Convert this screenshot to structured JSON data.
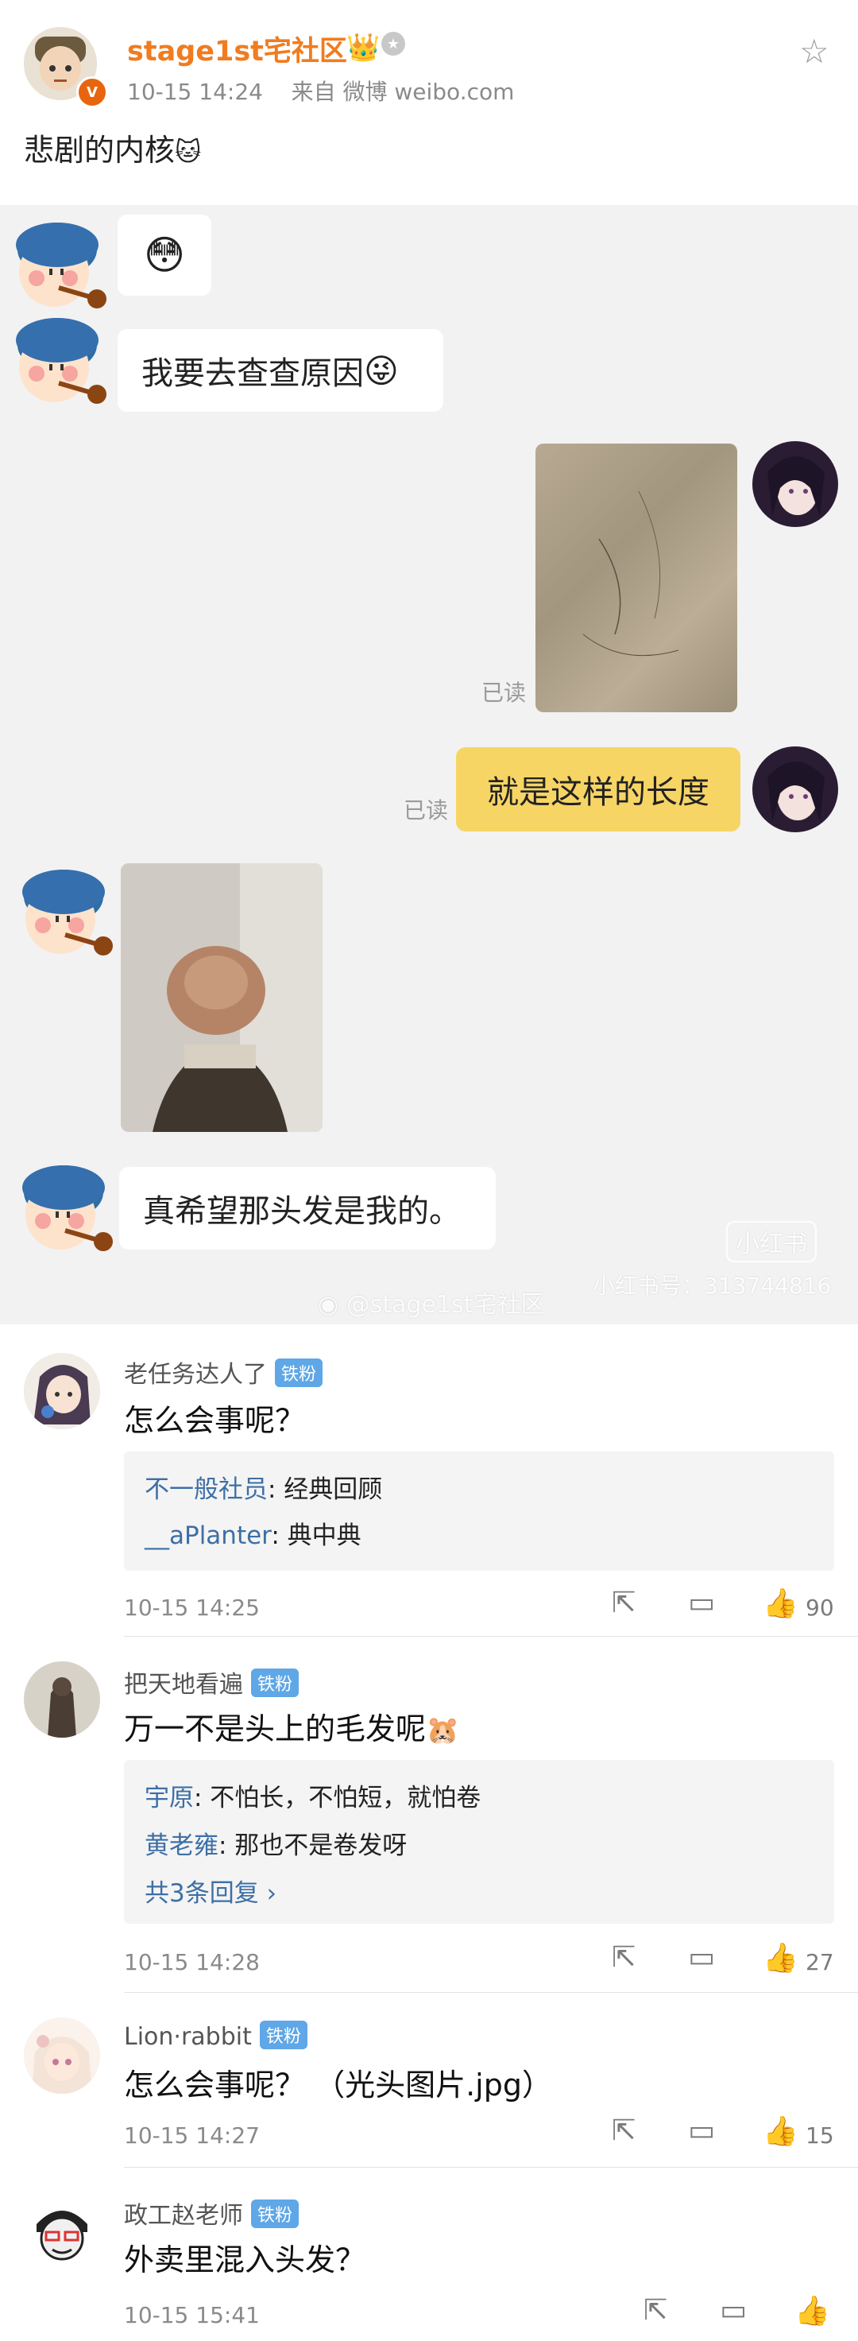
{
  "post": {
    "author": "stage1st宅社区",
    "time": "10-15 14:24",
    "source": "来自 微博 weibo.com",
    "text": "悲剧的内核",
    "emoji": "🐱"
  },
  "chat": {
    "msg1_emoji": "😳",
    "msg2": "我要去查查原因",
    "msg2_emoji": "😜",
    "read1": "已读",
    "msg4": "就是这样的长度",
    "read2": "已读",
    "msg6": "真希望那头发是我的。",
    "watermark_app": "小红书",
    "watermark_id": "小红书号：313744816",
    "watermark_weibo": "@stage1st宅社区"
  },
  "comments": [
    {
      "user": "老任务达人了",
      "badge": "铁粉",
      "text": "怎么会事呢？",
      "replies": [
        {
          "user": "不一般社员",
          "text": ": 经典回顾"
        },
        {
          "user": "__aPlanter",
          "text": ": 典中典"
        }
      ],
      "time": "10-15 14:25",
      "likes": "90"
    },
    {
      "user": "把天地看遍",
      "badge": "铁粉",
      "text": "万一不是头上的毛发呢",
      "emoji": "🐹",
      "replies": [
        {
          "user": "宇原",
          "text": ": 不怕长，不怕短，就怕卷"
        },
        {
          "user": "黄老雍",
          "text": ": 那也不是卷发呀"
        }
      ],
      "more": "共3条回复 ›",
      "time": "10-15 14:28",
      "likes": "27"
    },
    {
      "user": "Lion·rabbit",
      "badge": "铁粉",
      "text": "怎么会事呢？ （光头图片.jpg）",
      "time": "10-15 14:27",
      "likes": "15"
    },
    {
      "user": "政工赵老师",
      "badge": "铁粉",
      "text": "外卖里混入头发？",
      "time": "10-15 15:41",
      "likes": ""
    }
  ],
  "icons": {
    "share": "share-icon",
    "comment": "comment-icon",
    "like": "like-icon",
    "star": "star-icon"
  }
}
